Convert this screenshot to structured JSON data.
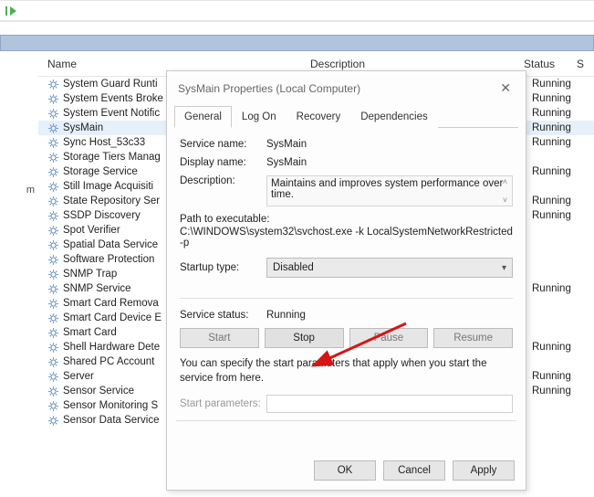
{
  "toolbar": {
    "play_label": "start"
  },
  "columns": {
    "name": "Name",
    "desc": "Description",
    "status": "Status",
    "startup": "S"
  },
  "gutter": {
    "label": "m"
  },
  "services": [
    {
      "name": "System Guard Runti",
      "status": "Running"
    },
    {
      "name": "System Events Broke",
      "status": "Running"
    },
    {
      "name": "System Event Notific",
      "status": "Running"
    },
    {
      "name": "SysMain",
      "status": "Running",
      "selected": true
    },
    {
      "name": "Sync Host_53c33",
      "status": "Running"
    },
    {
      "name": "Storage Tiers Manag",
      "status": ""
    },
    {
      "name": "Storage Service",
      "status": "Running"
    },
    {
      "name": "Still Image Acquisiti",
      "status": ""
    },
    {
      "name": "State Repository Ser",
      "status": "Running"
    },
    {
      "name": "SSDP Discovery",
      "status": "Running"
    },
    {
      "name": "Spot Verifier",
      "status": ""
    },
    {
      "name": "Spatial Data Service",
      "status": ""
    },
    {
      "name": "Software Protection",
      "status": ""
    },
    {
      "name": "SNMP Trap",
      "status": ""
    },
    {
      "name": "SNMP Service",
      "status": "Running"
    },
    {
      "name": "Smart Card Remova",
      "status": ""
    },
    {
      "name": "Smart Card Device E",
      "status": ""
    },
    {
      "name": "Smart Card",
      "status": ""
    },
    {
      "name": "Shell Hardware Dete",
      "status": "Running"
    },
    {
      "name": "Shared PC Account",
      "status": ""
    },
    {
      "name": "Server",
      "status": "Running"
    },
    {
      "name": "Sensor Service",
      "status": "Running"
    },
    {
      "name": "Sensor Monitoring S",
      "status": ""
    },
    {
      "name": "Sensor Data Service",
      "status": ""
    }
  ],
  "dialog": {
    "title": "SysMain Properties (Local Computer)",
    "tabs": {
      "general": "General",
      "logon": "Log On",
      "recovery": "Recovery",
      "deps": "Dependencies"
    },
    "labels": {
      "service_name": "Service name:",
      "display_name": "Display name:",
      "description": "Description:",
      "path": "Path to executable:",
      "startup_type": "Startup type:",
      "service_status": "Service status:",
      "start_params": "Start parameters:"
    },
    "values": {
      "service_name": "SysMain",
      "display_name": "SysMain",
      "description": "Maintains and improves system performance over time.",
      "path": "C:\\WINDOWS\\system32\\svchost.exe -k LocalSystemNetworkRestricted -p",
      "startup_type": "Disabled",
      "service_status": "Running"
    },
    "buttons": {
      "start": "Start",
      "stop": "Stop",
      "pause": "Pause",
      "resume": "Resume"
    },
    "hint": "You can specify the start parameters that apply when you start the service from here.",
    "footer": {
      "ok": "OK",
      "cancel": "Cancel",
      "apply": "Apply"
    }
  }
}
